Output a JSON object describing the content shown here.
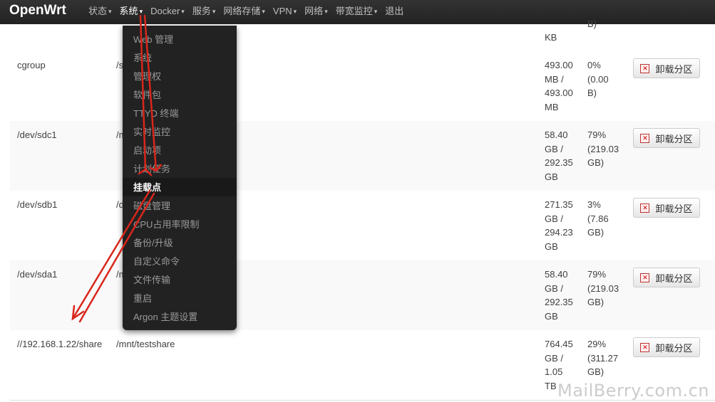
{
  "brand": "OpenWrt",
  "menu": [
    {
      "label": "状态",
      "caret": true
    },
    {
      "label": "系统",
      "caret": true
    },
    {
      "label": "Docker",
      "caret": true
    },
    {
      "label": "服务",
      "caret": true
    },
    {
      "label": "网络存储",
      "caret": true
    },
    {
      "label": "VPN",
      "caret": true
    },
    {
      "label": "网络",
      "caret": true
    },
    {
      "label": "带宽监控",
      "caret": true
    },
    {
      "label": "退出",
      "caret": false
    }
  ],
  "dropdown": {
    "items": [
      "Web 管理",
      "系统",
      "管理权",
      "软件包",
      "TTYD 终端",
      "实时监控",
      "启动项",
      "计划任务",
      "挂载点",
      "磁盘管理",
      "CPU占用率限制",
      "备份/升级",
      "自定义命令",
      "文件传输",
      "重启",
      "Argon 主题设置"
    ],
    "active_index": 8
  },
  "top_partial": {
    "size": "KB",
    "used": "B)"
  },
  "rows": [
    {
      "device": "cgroup",
      "mount": "/s",
      "size_lines": [
        "493.00",
        "MB /",
        "493.00",
        "MB"
      ],
      "used_lines": [
        "0%",
        "(0.00",
        "B)"
      ],
      "button": "卸载分区"
    },
    {
      "device": "/dev/sdc1",
      "mount": "/m",
      "size_lines": [
        "58.40",
        "GB /",
        "292.35",
        "GB"
      ],
      "used_lines": [
        "79%",
        "(219.03",
        "GB)"
      ],
      "button": "卸载分区"
    },
    {
      "device": "/dev/sdb1",
      "mount": "/d",
      "size_lines": [
        "271.35",
        "GB /",
        "294.23",
        "GB"
      ],
      "used_lines": [
        "3%",
        "(7.86",
        "GB)"
      ],
      "button": "卸载分区"
    },
    {
      "device": "/dev/sda1",
      "mount": "/m",
      "size_lines": [
        "58.40",
        "GB /",
        "292.35",
        "GB"
      ],
      "used_lines": [
        "79%",
        "(219.03",
        "GB)"
      ],
      "button": "卸载分区"
    },
    {
      "device": "//192.168.1.22/share",
      "mount": "/mnt/testshare",
      "size_lines": [
        "764.45",
        "GB /",
        "1.05",
        "TB"
      ],
      "used_lines": [
        "29%",
        "(311.27",
        "GB)"
      ],
      "button": "卸载分区"
    }
  ],
  "watermark": "MailBerry.com.cn",
  "colors": {
    "navbar": "#222222",
    "arrow": "#d9261c",
    "dropdown": "#222222"
  }
}
